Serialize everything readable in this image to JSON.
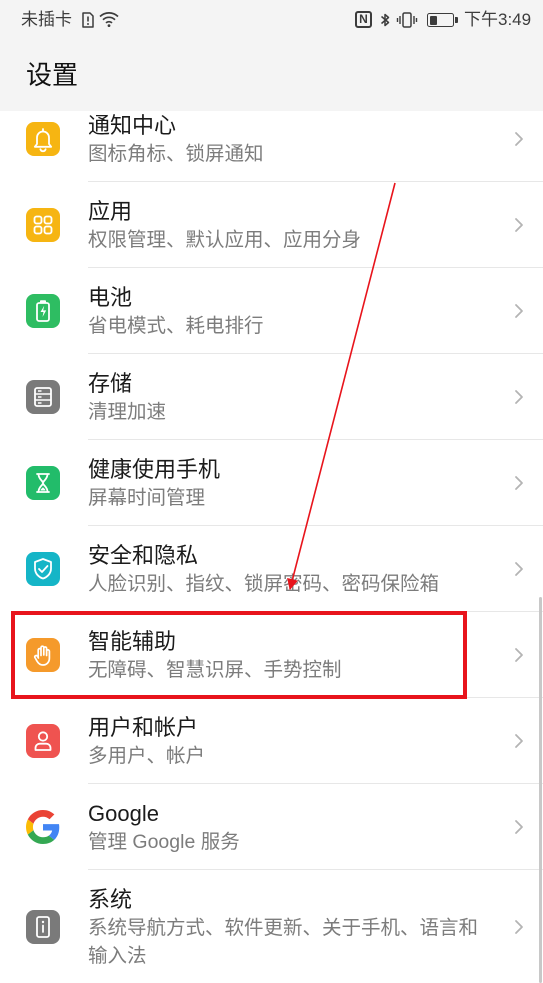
{
  "status_bar": {
    "carrier": "未插卡",
    "nfc_label": "N",
    "time": "下午3:49",
    "battery_level": 0.35,
    "icons": [
      "sim-icon",
      "wifi-icon",
      "nfc-icon",
      "bluetooth-icon",
      "vibrate-icon",
      "battery-status-icon"
    ]
  },
  "header": {
    "title": "设置"
  },
  "settings": {
    "items": [
      {
        "title": "通知中心",
        "subtitle": "图标角标、锁屏通知",
        "icon": "bell-icon",
        "color": "#F6B512"
      },
      {
        "title": "应用",
        "subtitle": "权限管理、默认应用、应用分身",
        "icon": "apps-grid-icon",
        "color": "#F6B512"
      },
      {
        "title": "电池",
        "subtitle": "省电模式、耗电排行",
        "icon": "battery-icon",
        "color": "#2EBD62"
      },
      {
        "title": "存储",
        "subtitle": "清理加速",
        "icon": "storage-icon",
        "color": "#7A7A7A"
      },
      {
        "title": "健康使用手机",
        "subtitle": "屏幕时间管理",
        "icon": "hourglass-icon",
        "color": "#22BC6A"
      },
      {
        "title": "安全和隐私",
        "subtitle": "人脸识别、指纹、锁屏密码、密码保险箱",
        "icon": "shield-check-icon",
        "color": "#15B5C7"
      },
      {
        "title": "智能辅助",
        "subtitle": "无障碍、智慧识屏、手势控制",
        "icon": "hand-icon",
        "color": "#F59A2B"
      },
      {
        "title": "用户和帐户",
        "subtitle": "多用户、帐户",
        "icon": "person-icon",
        "color": "#EF5350"
      },
      {
        "title": "Google",
        "subtitle": "管理 Google 服务",
        "icon": "google-icon",
        "color": "#FFFFFF"
      },
      {
        "title": "系统",
        "subtitle": "系统导航方式、软件更新、关于手机、语言和输入法",
        "icon": "system-info-icon",
        "color": "#7A7A7A"
      }
    ]
  },
  "annotation": {
    "color": "#E8141C"
  }
}
